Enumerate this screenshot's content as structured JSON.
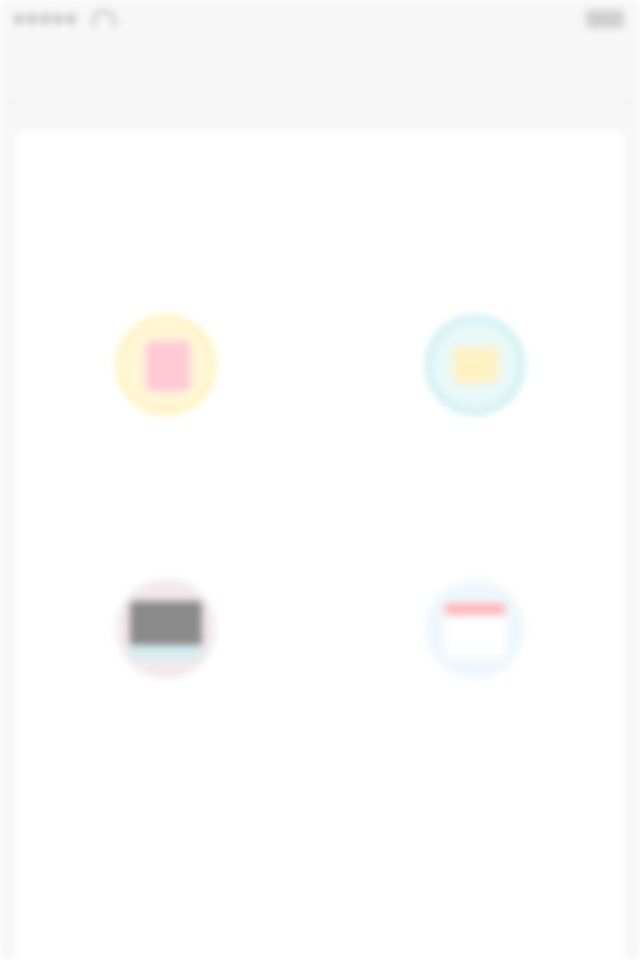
{
  "status_bar": {
    "carrier": "",
    "time": "",
    "battery": ""
  },
  "nav": {
    "title": "",
    "action": ""
  },
  "grid": {
    "items": [
      {
        "label": "",
        "icon": "ticket-icon"
      },
      {
        "label": "",
        "icon": "folder-icon"
      },
      {
        "label": "",
        "icon": "photo-icon"
      },
      {
        "label": "",
        "icon": "calendar-icon"
      }
    ]
  },
  "colors": {
    "background": "#f7f7f7",
    "card": "#ffffff",
    "accent_yellow": "#fff0b0",
    "accent_teal": "#c9eef0",
    "accent_red": "#ffb7b7"
  }
}
